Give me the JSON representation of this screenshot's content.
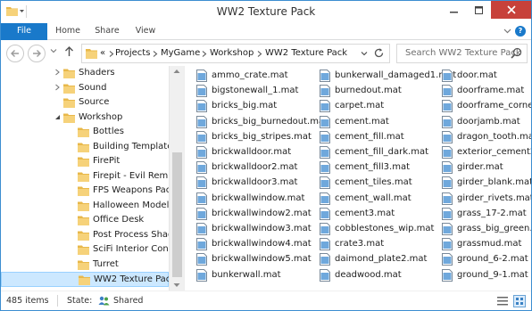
{
  "window": {
    "title": "WW2 Texture Pack"
  },
  "ribbon": {
    "tabs": [
      {
        "label": "File"
      },
      {
        "label": "Home"
      },
      {
        "label": "Share"
      },
      {
        "label": "View"
      }
    ]
  },
  "address": {
    "overflow": "«",
    "crumbs": [
      "Projects",
      "MyGame",
      "Workshop",
      "WW2 Texture Pack"
    ]
  },
  "search": {
    "placeholder": "Search WW2 Texture Pack"
  },
  "tree": {
    "items": [
      {
        "label": "Shaders",
        "expandable": true,
        "indent": 0
      },
      {
        "label": "Sound",
        "expandable": true,
        "indent": 0
      },
      {
        "label": "Source",
        "expandable": false,
        "indent": 0
      },
      {
        "label": "Workshop",
        "expandable": true,
        "expanded": true,
        "indent": 0
      },
      {
        "label": "Bottles",
        "indent": 1
      },
      {
        "label": "Building Template",
        "indent": 1
      },
      {
        "label": "FirePit",
        "indent": 1
      },
      {
        "label": "Firepit - Evil Remix",
        "indent": 1
      },
      {
        "label": "FPS Weapons Pack",
        "indent": 1
      },
      {
        "label": "Halloween Model Pack",
        "indent": 1
      },
      {
        "label": "Office Desk",
        "indent": 1
      },
      {
        "label": "Post Process Shaders (s",
        "indent": 1
      },
      {
        "label": "SciFi Interior Constructi",
        "indent": 1
      },
      {
        "label": "Turret",
        "indent": 1
      },
      {
        "label": "WW2 Texture Pack",
        "indent": 1,
        "selected": true
      }
    ]
  },
  "files": {
    "columns": [
      [
        "ammo_crate.mat",
        "bigstonewall_1.mat",
        "bricks_big.mat",
        "bricks_big_burnedout.mat",
        "bricks_big_stripes.mat",
        "brickwalldoor.mat",
        "brickwalldoor2.mat",
        "brickwalldoor3.mat",
        "brickwallwindow.mat",
        "brickwallwindow2.mat",
        "brickwallwindow3.mat",
        "brickwallwindow4.mat",
        "brickwallwindow5.mat",
        "bunkerwall.mat"
      ],
      [
        "bunkerwall_damaged1.mat",
        "burnedout.mat",
        "carpet.mat",
        "cement.mat",
        "cement_fill.mat",
        "cement_fill_dark.mat",
        "cement_fill3.mat",
        "cement_tiles.mat",
        "cement_wall.mat",
        "cement3.mat",
        "cobblestones_wip.mat",
        "crate3.mat",
        "daimond_plate2.mat",
        "deadwood.mat"
      ],
      [
        "door.mat",
        "doorframe.mat",
        "doorframe_corner.r",
        "doorjamb.mat",
        "dragon_tooth.mat",
        "exterior_cement2.n",
        "girder.mat",
        "girder_blank.mat",
        "girder_rivets.mat",
        "grass_17-2.mat",
        "grass_big_green.ma",
        "grassmud.mat",
        "ground_6-2.mat",
        "ground_9-1.mat"
      ]
    ]
  },
  "status": {
    "items_count": "485 items",
    "state_label": "State:",
    "state_value": "Shared"
  },
  "colors": {
    "accent": "#1979ca",
    "selection": "#cce8ff",
    "close": "#c7413a",
    "folder": "#e8b84a"
  }
}
